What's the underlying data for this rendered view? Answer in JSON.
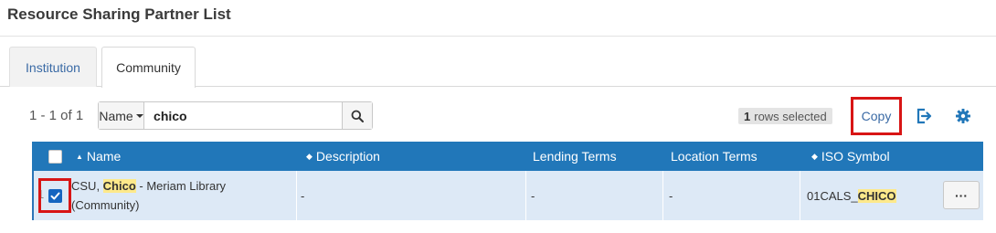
{
  "page": {
    "title": "Resource Sharing Partner List"
  },
  "tabs": [
    {
      "label": "Institution",
      "active": false
    },
    {
      "label": "Community",
      "active": true
    }
  ],
  "toolbar": {
    "count": "1 - 1 of 1",
    "search_field": "Name",
    "search_value": "chico",
    "rows_selected_count": "1",
    "rows_selected_label": "rows selected",
    "copy_label": "Copy"
  },
  "table": {
    "columns": [
      {
        "label": "Name",
        "sort": "asc"
      },
      {
        "label": "Description",
        "sort": "both"
      },
      {
        "label": "Lending Terms"
      },
      {
        "label": "Location Terms"
      },
      {
        "label": "ISO Symbol",
        "sort": "both"
      }
    ],
    "rows": [
      {
        "number": "1",
        "checked": true,
        "name_prefix": "CSU, ",
        "name_highlight": "Chico",
        "name_suffix": " - Meriam Library",
        "name_line2": "(Community)",
        "description": "-",
        "lending_terms": "-",
        "location_terms": "-",
        "iso_prefix": "01CALS_",
        "iso_highlight": "CHICO",
        "actions_label": "···"
      }
    ]
  },
  "colors": {
    "accent": "#2177b9",
    "link": "#3a6aa5",
    "highlight": "#fde98b",
    "annotation": "#d81515",
    "selected_row": "#dde9f6"
  },
  "icons": {
    "sort_asc": "▲",
    "sort_both": "◆",
    "search": "search-icon",
    "export": "export-icon",
    "settings": "gear-icon",
    "checkbox": "checkmark-icon"
  }
}
